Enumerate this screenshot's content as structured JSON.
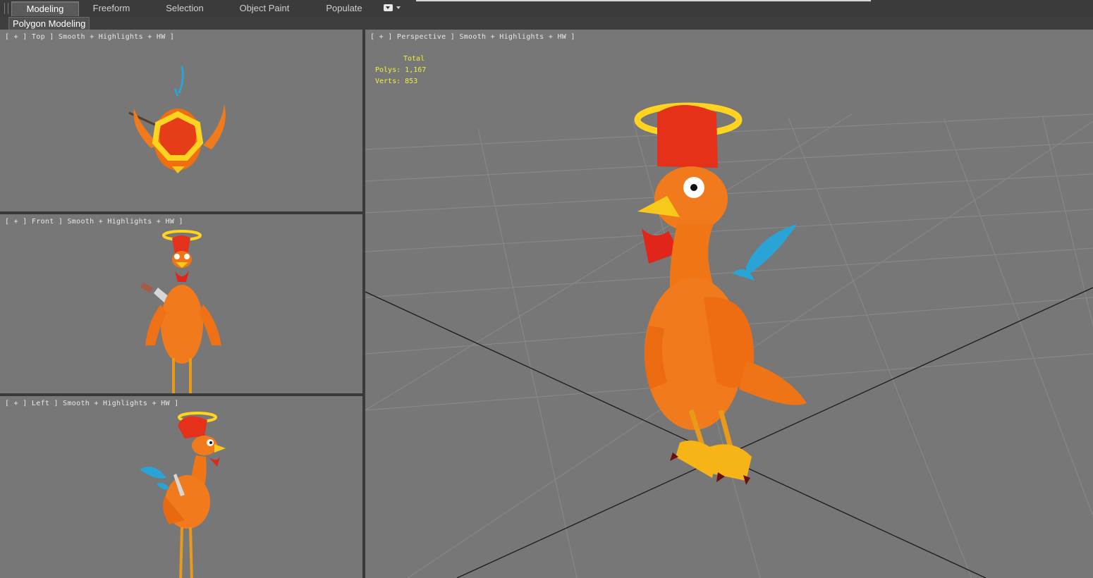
{
  "ribbon": {
    "tabs": [
      "Modeling",
      "Freeform",
      "Selection",
      "Object Paint",
      "Populate"
    ],
    "active_tab": "Modeling",
    "panel_label": "Polygon Modeling"
  },
  "viewports": {
    "top": {
      "label": "[ + ] Top ] Smooth + Highlights + HW ]"
    },
    "front": {
      "label": "[ + ] Front ] Smooth + Highlights + HW ]"
    },
    "left": {
      "label": "[ + ] Left ] Smooth + Highlights + HW ]"
    },
    "perspective": {
      "label": "[ + ] Perspective ] Smooth + Highlights + HW ]",
      "stats": {
        "header": "Total",
        "polys_label": "Polys:",
        "polys": "1,167",
        "verts_label": "Verts:",
        "verts": "853"
      }
    }
  },
  "colors": {
    "viewport_bg": "#777777",
    "stats_text": "#f1ef3d",
    "active_border": "#7d7d7d",
    "grid_line": "#8a8a8a"
  },
  "icons": {
    "ribbon_options": "ribbon-options-icon",
    "character": "rooster-model"
  }
}
